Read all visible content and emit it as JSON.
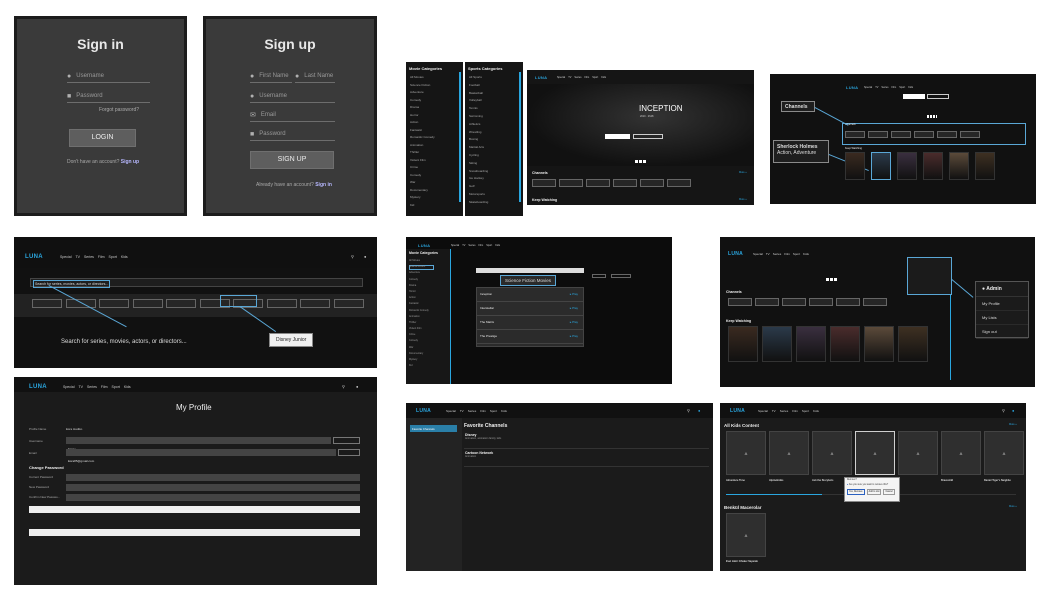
{
  "signin": {
    "title": "Sign in",
    "username": "Username",
    "password": "Password",
    "forgot": "Forgot password?",
    "button": "LOGIN",
    "footer_text": "Don't have an account?",
    "footer_link": "Sign up"
  },
  "signup": {
    "title": "Sign up",
    "first_name": "First Name",
    "last_name": "Last Name",
    "username": "Username",
    "email": "Email",
    "password": "Password",
    "button": "SIGN UP",
    "footer_text": "Already have an account?",
    "footer_link": "Sign in"
  },
  "brand": "LUNA",
  "nav": [
    "Special",
    "TV",
    "Series",
    "Film",
    "Sport",
    "Kids"
  ],
  "categories": {
    "movie_title": "Movie Categories",
    "sports_title": "Sports Categories",
    "movie_items": [
      "All Movies",
      "Science Fiction",
      "Adventure",
      "Comedy",
      "Drama",
      "Horror",
      "Action",
      "Fantastic",
      "Romantic Comedy",
      "Animation",
      "Thriller",
      "Violent Film",
      "Crime",
      "Comedy",
      "War",
      "Documentary",
      "Mystery",
      "Kid"
    ],
    "sports_items": [
      "All Sports",
      "Football",
      "Basketball",
      "Volleyball",
      "Tennis",
      "Swimming",
      "Athletics",
      "Wrestling",
      "Boxing",
      "Martial Arts",
      "Cycling",
      "Skiing",
      "Snowboarding",
      "Ice Hockey",
      "Golf",
      "Motorsports",
      "Skateboarding"
    ]
  },
  "hero": {
    "title": "INCEPTION",
    "meta": "2010 · 2h28",
    "channels": "Channels",
    "keep_watching": "Keep Watching",
    "more": "More »"
  },
  "channels_panel": {
    "callout_channels": "Channels",
    "callout_show_title": "Sherlock Holmes",
    "callout_show_genre": "Action, Adventure",
    "section_channels": "Channels",
    "section_keep": "Keep Watching"
  },
  "search": {
    "placeholder": "Search for series, movies, actors, or directors...",
    "callout": "Search for series, movies, actors, or directors...",
    "callout_chip": "Disney Junior"
  },
  "scifi": {
    "header": "Movie Categories",
    "callout": "Science Fiction Movies",
    "items": [
      "Inception",
      "Interstellar",
      "The Matrix",
      "The Prestige"
    ],
    "play": "▸ Play"
  },
  "admin": {
    "header": "Admin",
    "items": [
      "My Profile",
      "My Lists",
      "Sign out"
    ],
    "channels": "Channels",
    "keep_watching": "Keep Watching"
  },
  "profile": {
    "title": "My Profile",
    "profile_name_label": "Profile Name",
    "profile_name_value": "Esra Hadiko",
    "username_label": "Username",
    "username_value": "Esray",
    "email_label": "Email",
    "email_value": "Esra85@gmail.com",
    "change_password": "Change Password",
    "current_password": "Current Password",
    "new_password": "New Password",
    "confirm_password": "Confirm New Passwo..."
  },
  "favorites": {
    "sidebar_item": "Favorite Channels",
    "title": "Favorite Channels",
    "items": [
      {
        "name": "Disney",
        "desc": "Animation, animation family, kids"
      },
      {
        "name": "Cartoon Network",
        "desc": "Animation"
      }
    ]
  },
  "kids": {
    "section1": "All Kids Content",
    "more": "More »",
    "tiles": [
      "A",
      "A",
      "A",
      "A",
      "A",
      "A",
      "A"
    ],
    "titles": [
      "Adventure Time",
      "Alpinebrüks",
      "Ask the Storybots",
      "",
      "",
      "Bravestild",
      "Daniel Tiger's Neighbo"
    ],
    "section2": "Benkül Macerolar",
    "tile2": "A",
    "title2": "Evel Jakir: Efsaler Sayarak",
    "dialog_title": "Remove?",
    "dialog_text": "Are you sure you want to remove this?",
    "dialog_buttons": [
      "Yes, Remove",
      "Add to List",
      "Cancel"
    ]
  },
  "colors": {
    "accent": "#2aa6df",
    "bg": "#151515",
    "auth_bg": "#3a3a3a"
  }
}
